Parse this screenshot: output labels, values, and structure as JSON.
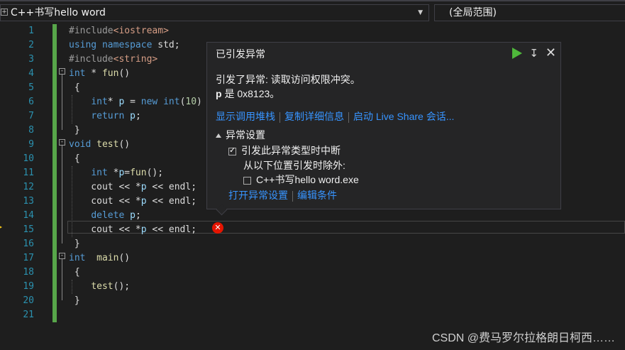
{
  "scope_bar": {
    "project": "C++书写hello word",
    "scope": "(全局范围)"
  },
  "code_lines": [
    {
      "n": "1",
      "text": "#include<iostream>"
    },
    {
      "n": "2",
      "text": "using namespace std;"
    },
    {
      "n": "3",
      "text": "#include<string>"
    },
    {
      "n": "4",
      "text": "int * fun()"
    },
    {
      "n": "5",
      "text": "{"
    },
    {
      "n": "6",
      "text": "int* p = new int(10)"
    },
    {
      "n": "7",
      "text": "return p;"
    },
    {
      "n": "8",
      "text": "}"
    },
    {
      "n": "9",
      "text": "void test()"
    },
    {
      "n": "10",
      "text": "{"
    },
    {
      "n": "11",
      "text": "int *p=fun();"
    },
    {
      "n": "12",
      "text": "cout << *p << endl;"
    },
    {
      "n": "13",
      "text": "cout << *p << endl;"
    },
    {
      "n": "14",
      "text": "delete p;"
    },
    {
      "n": "15",
      "text": "cout << *p << endl;"
    },
    {
      "n": "16",
      "text": "}"
    },
    {
      "n": "17",
      "text": "int  main()"
    },
    {
      "n": "18",
      "text": "{"
    },
    {
      "n": "19",
      "text": "test();"
    },
    {
      "n": "20",
      "text": "}"
    },
    {
      "n": "21",
      "text": ""
    }
  ],
  "exception": {
    "title": "已引发异常",
    "message": "引发了异常: 读取访问权限冲突。",
    "value_var": "p",
    "value_text": " 是 0x8123。",
    "link_call_stack": "显示调用堆栈",
    "link_copy": "复制详细信息",
    "link_liveshare": "启动 Live Share 会话...",
    "settings_header": "异常设置",
    "break_label": "引发此异常类型时中断",
    "except_label": "从以下位置引发时除外:",
    "exe_label": "C++书写hello word.exe",
    "link_open_settings": "打开异常设置",
    "link_edit_conditions": "编辑条件"
  },
  "watermark": "CSDN @费马罗尔拉格朗日柯西……",
  "colors": {
    "editor_bg": "#1e1e1e",
    "keyword": "#569cd6",
    "line_number": "#2b91af",
    "link": "#3794ff",
    "change_bar": "#57a64a",
    "error": "#e51400"
  }
}
